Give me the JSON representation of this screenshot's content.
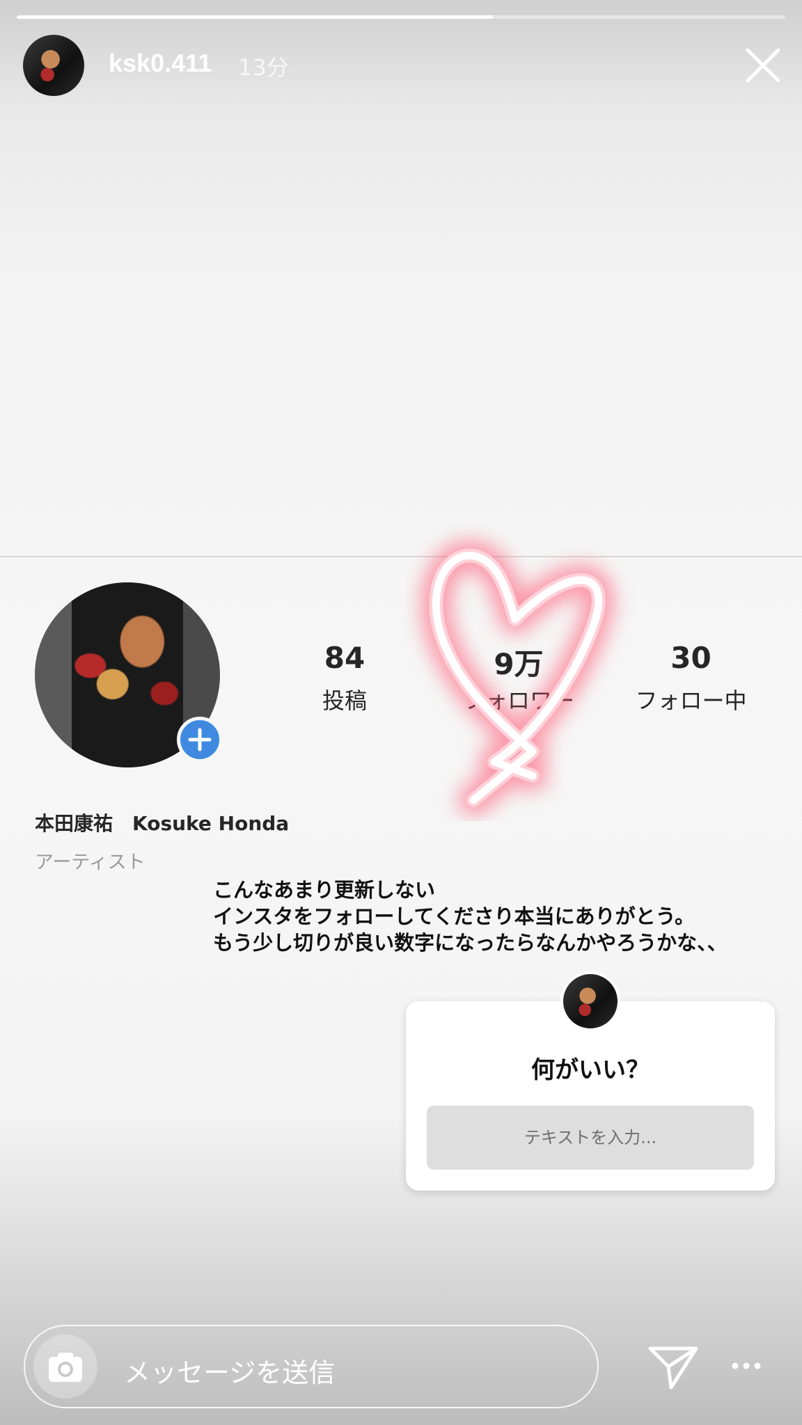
{
  "story": {
    "progress_fraction": 0.62
  },
  "header": {
    "username": "ksk0.411",
    "time_ago": "13分",
    "close_icon": "close-icon"
  },
  "profile": {
    "stats": [
      {
        "value": "84",
        "label": "投稿"
      },
      {
        "value": "9万",
        "label": "フォロワー"
      },
      {
        "value": "30",
        "label": "フォロー中"
      }
    ],
    "name": "本田康祐　Kosuke Honda",
    "category": "アーティスト"
  },
  "caption": {
    "lines": [
      "こんなあまり更新しない",
      "インスタをフォローしてくださり本当にありがとう。",
      "もう少し切りが良い数字になったらなんかやろうかな、、"
    ]
  },
  "question_sticker": {
    "question": "何がいい？",
    "placeholder": "テキストを入力..."
  },
  "footer": {
    "message_placeholder": "メッセージを送信",
    "icons": [
      "camera-icon",
      "send-icon",
      "more-icon"
    ]
  },
  "colors": {
    "accent_blue": "#3f8ae0",
    "heart_glow": "#ff4d6d"
  }
}
